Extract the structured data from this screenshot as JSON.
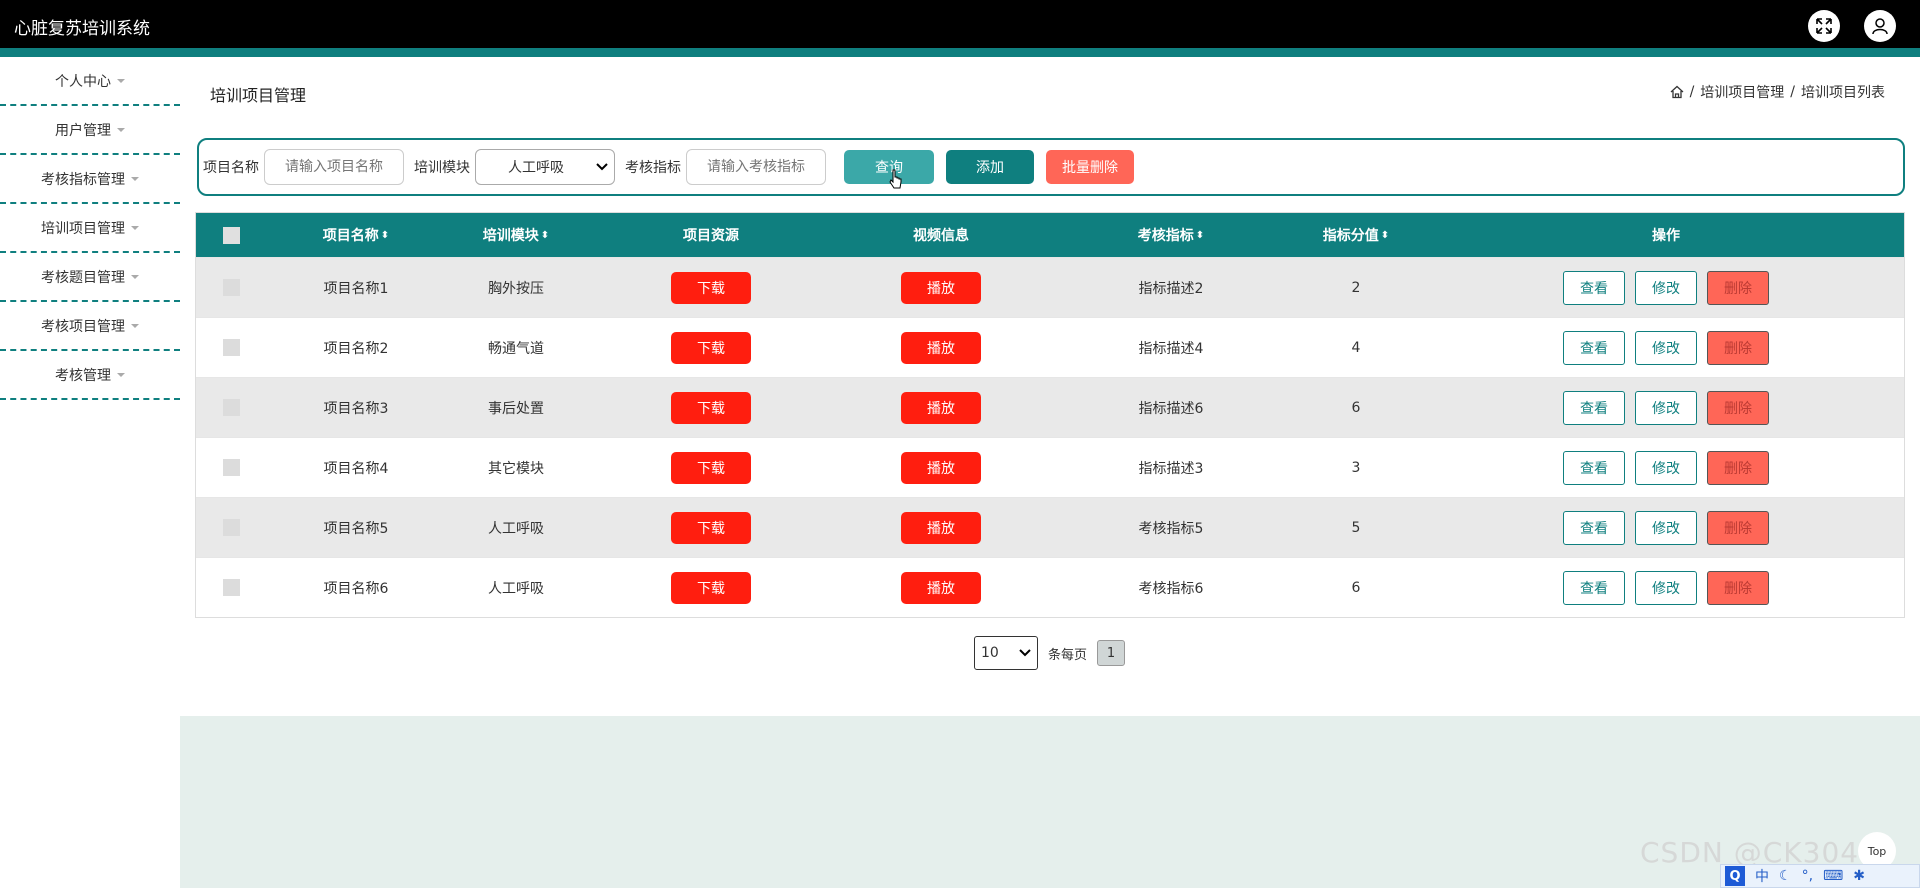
{
  "app": {
    "title": "心脏复苏培训系统",
    "fullscreen_icon": "expand-icon",
    "user_icon": "user-icon"
  },
  "sidebar": {
    "items": [
      {
        "label": "个人中心"
      },
      {
        "label": "用户管理"
      },
      {
        "label": "考核指标管理"
      },
      {
        "label": "培训项目管理"
      },
      {
        "label": "考核题目管理"
      },
      {
        "label": "考核项目管理"
      },
      {
        "label": "考核管理"
      }
    ]
  },
  "page": {
    "title": "培训项目管理",
    "breadcrumb": [
      "培训项目管理",
      "培训项目列表"
    ]
  },
  "search": {
    "name_label": "项目名称",
    "name_placeholder": "请输入项目名称",
    "module_label": "培训模块",
    "module_value": "人工呼吸",
    "indicator_label": "考核指标",
    "indicator_placeholder": "请输入考核指标",
    "query_label": "查询",
    "add_label": "添加",
    "bulk_delete_label": "批量删除"
  },
  "table": {
    "headers": {
      "name": "项目名称",
      "module": "培训模块",
      "resource": "项目资源",
      "video": "视频信息",
      "indicator": "考核指标",
      "score": "指标分值",
      "actions": "操作"
    },
    "download_label": "下载",
    "play_label": "播放",
    "view_label": "查看",
    "edit_label": "修改",
    "delete_label": "删除",
    "rows": [
      {
        "name": "项目名称1",
        "module": "胸外按压",
        "indicator": "指标描述2",
        "score": "2"
      },
      {
        "name": "项目名称2",
        "module": "畅通气道",
        "indicator": "指标描述4",
        "score": "4"
      },
      {
        "name": "项目名称3",
        "module": "事后处置",
        "indicator": "指标描述6",
        "score": "6"
      },
      {
        "name": "项目名称4",
        "module": "其它模块",
        "indicator": "指标描述3",
        "score": "3"
      },
      {
        "name": "项目名称5",
        "module": "人工呼吸",
        "indicator": "考核指标5",
        "score": "5"
      },
      {
        "name": "项目名称6",
        "module": "人工呼吸",
        "indicator": "考核指标6",
        "score": "6"
      }
    ]
  },
  "pager": {
    "page_size": "10",
    "per_page_label": "条每页",
    "current_page": "1"
  },
  "misc": {
    "top_label": "Top",
    "watermark": "CSDN @CK3041",
    "ime_lang": "中"
  },
  "colors": {
    "accent": "#0f7f7f",
    "danger": "#ff1e0f",
    "danger_soft": "#ff6657"
  }
}
